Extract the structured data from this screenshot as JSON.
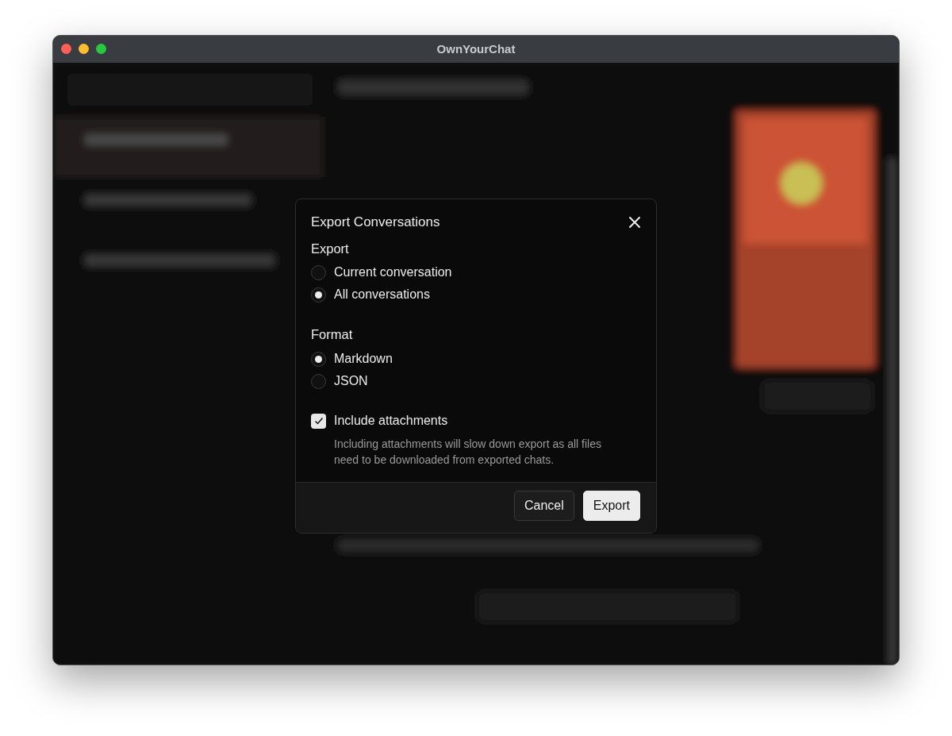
{
  "window": {
    "title": "OwnYourChat"
  },
  "dialog": {
    "title": "Export Conversations",
    "sections": [
      {
        "heading": "Export",
        "options": [
          {
            "label": "Current conversation",
            "selected": false
          },
          {
            "label": "All conversations",
            "selected": true
          }
        ]
      },
      {
        "heading": "Format",
        "options": [
          {
            "label": "Markdown",
            "selected": true
          },
          {
            "label": "JSON",
            "selected": false
          }
        ]
      }
    ],
    "attachments": {
      "label": "Include attachments",
      "checked": true,
      "hint": "Including attachments will slow down export as all files need to be downloaded from exported chats."
    },
    "buttons": [
      {
        "label": "Cancel",
        "kind": "secondary"
      },
      {
        "label": "Export",
        "kind": "primary"
      }
    ]
  }
}
